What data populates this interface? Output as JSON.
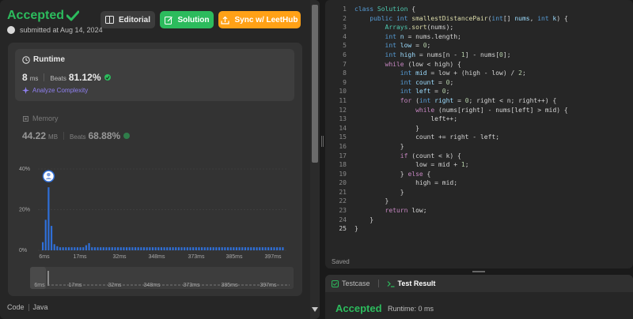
{
  "submission": {
    "status": "Accepted",
    "submitted_text": "submitted at Aug 14, 2024",
    "buttons": {
      "editorial": "Editorial",
      "solution": "Solution",
      "sync": "Sync w/ LeetHub"
    }
  },
  "runtime": {
    "label": "Runtime",
    "value": "8",
    "unit": "ms",
    "beats_label": "Beats",
    "beats_value": "81.12%",
    "analyze_label": "Analyze Complexity"
  },
  "memory": {
    "label": "Memory",
    "value": "44.22",
    "unit": "MB",
    "beats_label": "Beats",
    "beats_value": "68.88%"
  },
  "chart_data": {
    "type": "bar",
    "y_ticks": [
      "40%",
      "20%",
      "0%"
    ],
    "ylim": [
      0,
      40
    ],
    "x_ticks": [
      "6ms",
      "17ms",
      "32ms",
      "348ms",
      "373ms",
      "385ms",
      "397ms"
    ],
    "values": [
      4,
      15,
      31,
      12,
      3,
      2,
      1.5,
      1.5,
      1.5,
      1.5,
      1.5,
      1.5,
      1.5,
      1.5,
      1.5,
      2.5,
      3.5,
      1.5,
      1.5,
      1.5,
      1.5,
      1.5,
      1.5,
      1.5,
      1.5,
      1.5,
      1.5,
      1.5,
      1.5,
      1.5,
      1.5,
      1.5,
      1.5,
      1.5,
      1.5,
      1.5,
      1.5,
      1.5,
      1.5,
      1.5,
      1.5,
      1.5,
      1.5,
      1.5,
      1.5,
      1.5,
      1.5,
      1.5,
      1.5,
      1.5,
      1.5,
      1.5,
      1.5,
      1.5,
      1.5,
      1.5,
      1.5,
      1.5,
      1.5,
      1.5,
      1.5,
      1.5,
      1.5,
      1.5,
      1.5,
      1.5,
      1.5,
      1.5,
      1.5,
      1.5,
      1.5,
      1.5,
      1.5,
      1.5,
      1.5,
      1.5,
      1.5,
      1.5,
      1.5,
      1.5,
      1.5,
      1.5,
      1.5,
      1.5
    ],
    "highlight_index": 2,
    "bar_color": "#2f6fd8",
    "minimap_ticks": [
      "6ms",
      "17ms",
      "32ms",
      "348ms",
      "373ms",
      "385ms",
      "397ms"
    ]
  },
  "footer": {
    "code_label": "Code",
    "language": "Java"
  },
  "editor": {
    "lines": [
      [
        [
          "kw",
          "class "
        ],
        [
          "ty",
          "Solution"
        ],
        [
          "p",
          " {"
        ]
      ],
      [
        [
          "p",
          "    "
        ],
        [
          "kw",
          "public int "
        ],
        [
          "fn",
          "smallestDistancePair"
        ],
        [
          "p",
          "("
        ],
        [
          "kw",
          "int"
        ],
        [
          "p",
          "[] "
        ],
        [
          "var",
          "nums"
        ],
        [
          "p",
          ", "
        ],
        [
          "kw",
          "int "
        ],
        [
          "var",
          "k"
        ],
        [
          "p",
          ") {"
        ]
      ],
      [
        [
          "p",
          "        "
        ],
        [
          "ty",
          "Arrays"
        ],
        [
          "p",
          "."
        ],
        [
          "fn",
          "sort"
        ],
        [
          "p",
          "(nums);"
        ]
      ],
      [
        [
          "p",
          "        "
        ],
        [
          "kw",
          "int "
        ],
        [
          "var",
          "n"
        ],
        [
          "p",
          " = nums.length;"
        ]
      ],
      [
        [
          "p",
          "        "
        ],
        [
          "kw",
          "int "
        ],
        [
          "var",
          "low"
        ],
        [
          "p",
          " = "
        ],
        [
          "num",
          "0"
        ],
        [
          "p",
          ";"
        ]
      ],
      [
        [
          "p",
          "        "
        ],
        [
          "kw",
          "int "
        ],
        [
          "var",
          "high"
        ],
        [
          "p",
          " = nums[n - "
        ],
        [
          "num",
          "1"
        ],
        [
          "p",
          "] - nums["
        ],
        [
          "num",
          "0"
        ],
        [
          "p",
          "];"
        ]
      ],
      [
        [
          "p",
          "        "
        ],
        [
          "ctl",
          "while"
        ],
        [
          "p",
          " (low < high) {"
        ]
      ],
      [
        [
          "p",
          "            "
        ],
        [
          "kw",
          "int "
        ],
        [
          "var",
          "mid"
        ],
        [
          "p",
          " = low + (high - low) / "
        ],
        [
          "num",
          "2"
        ],
        [
          "p",
          ";"
        ]
      ],
      [
        [
          "p",
          "            "
        ],
        [
          "kw",
          "int "
        ],
        [
          "var",
          "count"
        ],
        [
          "p",
          " = "
        ],
        [
          "num",
          "0"
        ],
        [
          "p",
          ";"
        ]
      ],
      [
        [
          "p",
          "            "
        ],
        [
          "kw",
          "int "
        ],
        [
          "var",
          "left"
        ],
        [
          "p",
          " = "
        ],
        [
          "num",
          "0"
        ],
        [
          "p",
          ";"
        ]
      ],
      [
        [
          "p",
          "            "
        ],
        [
          "ctl",
          "for"
        ],
        [
          "p",
          " ("
        ],
        [
          "kw",
          "int "
        ],
        [
          "var",
          "right"
        ],
        [
          "p",
          " = "
        ],
        [
          "num",
          "0"
        ],
        [
          "p",
          "; right < n; right++) {"
        ]
      ],
      [
        [
          "p",
          "                "
        ],
        [
          "ctl",
          "while"
        ],
        [
          "p",
          " (nums[right] - nums[left] > mid) {"
        ]
      ],
      [
        [
          "p",
          "                    left++;"
        ]
      ],
      [
        [
          "p",
          "                }"
        ]
      ],
      [
        [
          "p",
          "                count += right - left;"
        ]
      ],
      [
        [
          "p",
          "            }"
        ]
      ],
      [
        [
          "p",
          "            "
        ],
        [
          "ctl",
          "if"
        ],
        [
          "p",
          " (count < k) {"
        ]
      ],
      [
        [
          "p",
          "                low = mid + "
        ],
        [
          "num",
          "1"
        ],
        [
          "p",
          ";"
        ]
      ],
      [
        [
          "p",
          "            } "
        ],
        [
          "ctl",
          "else"
        ],
        [
          "p",
          " {"
        ]
      ],
      [
        [
          "p",
          "                high = mid;"
        ]
      ],
      [
        [
          "p",
          "            }"
        ]
      ],
      [
        [
          "p",
          "        }"
        ]
      ],
      [
        [
          "p",
          "        "
        ],
        [
          "ctl",
          "return"
        ],
        [
          "p",
          " low;"
        ]
      ],
      [
        [
          "p",
          "    }"
        ]
      ],
      [
        [
          "p",
          "}"
        ]
      ]
    ],
    "active_line": 25,
    "saved_label": "Saved"
  },
  "result_panel": {
    "tab_testcase": "Testcase",
    "tab_result": "Test Result",
    "status": "Accepted",
    "runtime_text": "Runtime: 0 ms"
  },
  "colors": {
    "accepted": "#2cbb5d",
    "sync": "#ffa116",
    "bar": "#2f6fd8"
  }
}
